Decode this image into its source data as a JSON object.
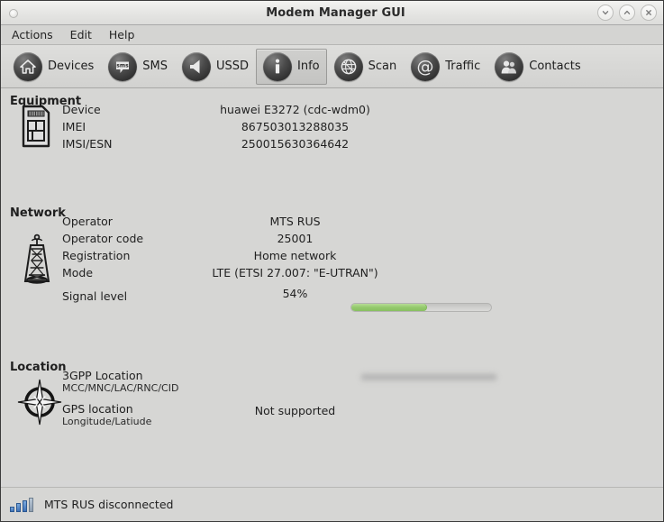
{
  "window": {
    "title": "Modem Manager GUI",
    "buttons": [
      {
        "name": "minimize",
        "glyph": "chevron-down"
      },
      {
        "name": "maximize",
        "glyph": "chevron-up"
      },
      {
        "name": "close",
        "glyph": "x"
      }
    ]
  },
  "menubar": {
    "items": [
      "Actions",
      "Edit",
      "Help"
    ]
  },
  "toolbar": {
    "items": [
      {
        "label": "Devices",
        "icon": "home-icon",
        "active": false
      },
      {
        "label": "SMS",
        "icon": "sms-icon",
        "active": false
      },
      {
        "label": "USSD",
        "icon": "ussd-icon",
        "active": false
      },
      {
        "label": "Info",
        "icon": "info-icon",
        "active": true
      },
      {
        "label": "Scan",
        "icon": "globe-icon",
        "active": false
      },
      {
        "label": "Traffic",
        "icon": "at-sign-icon",
        "active": false
      },
      {
        "label": "Contacts",
        "icon": "contacts-icon",
        "active": false
      }
    ]
  },
  "sections": {
    "equipment": {
      "title": "Equipment",
      "icon": "sim-card-icon",
      "rows": [
        {
          "label": "Device",
          "value": "huawei E3272 (cdc-wdm0)"
        },
        {
          "label": "IMEI",
          "value": "867503013288035"
        },
        {
          "label": "IMSI/ESN",
          "value": "250015630364642"
        }
      ]
    },
    "network": {
      "title": "Network",
      "icon": "cell-tower-icon",
      "rows": [
        {
          "label": "Operator",
          "value": "MTS RUS"
        },
        {
          "label": "Operator code",
          "value": "25001"
        },
        {
          "label": "Registration",
          "value": "Home network"
        },
        {
          "label": "Mode",
          "value": "LTE (ETSI 27.007: \"E-UTRAN\")"
        }
      ],
      "signal": {
        "label": "Signal level",
        "value_text": "54%",
        "percent": 54,
        "fill_color": "#93c96c"
      }
    },
    "location": {
      "title": "Location",
      "icon": "compass-icon",
      "rows": [
        {
          "label": "3GPP Location",
          "sublabel": "MCC/MNC/LAC/RNC/CID",
          "value": "",
          "redacted": true
        },
        {
          "label": "GPS location",
          "sublabel": "Longitude/Latiude",
          "value": "Not supported",
          "redacted": false
        }
      ]
    }
  },
  "statusbar": {
    "icon": "signal-bars-icon",
    "text": "MTS RUS disconnected"
  }
}
